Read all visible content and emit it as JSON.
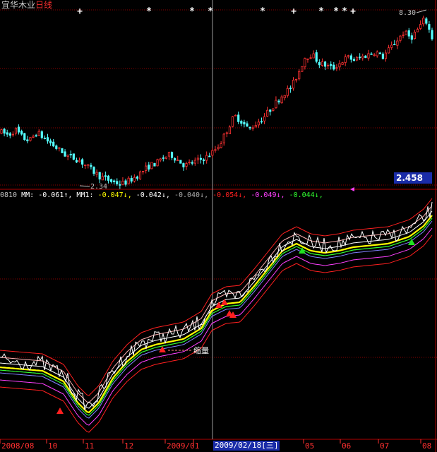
{
  "header": {
    "stock_name": "宜华木业",
    "period": "日线",
    "colors": {
      "name": "#c8c8c8",
      "period": "#ff3030"
    }
  },
  "price_panel": {
    "current_price_label": "2.458",
    "high_label": "8.30",
    "low_label": "2.34",
    "marks_label": "+",
    "stars_label": "*",
    "bull_color": "#ff3232",
    "bear_color": "#54ffff"
  },
  "indicator_panel": {
    "code": "0810",
    "mm_label": "MM:",
    "mm_value": "-0.061↑,",
    "mm1_label": "MM1:",
    "mm1_value": "-0.047↓,",
    "v3": "-0.042↓,",
    "v4": "-0.040↓,",
    "v5": "-0.054↓,",
    "v6": "-0.049↓,",
    "v7": "-0.044↓,",
    "annotation": "缩量",
    "colors": {
      "white": "#ffffff",
      "yellow": "#ffff00",
      "green": "#30ff30",
      "red": "#ff2020",
      "magenta": "#ff40ff",
      "buy_marker": "#ff2020",
      "sell_marker": "#20e020"
    }
  },
  "axis": {
    "labels": [
      "2008/08",
      "10",
      "11",
      "12",
      "2009/01",
      "02",
      "05",
      "06",
      "07",
      "08"
    ],
    "selected_date": "2009/02/18[三]"
  },
  "chart_data": [
    {
      "type": "line",
      "title": "宜华木业 日线",
      "x_ticks": [
        "2008/08",
        "10",
        "11",
        "12",
        "2009/01",
        "02",
        "05",
        "06",
        "07",
        "08"
      ],
      "y_annotations": {
        "high": 8.3,
        "low": 2.34,
        "current": 2.458
      },
      "series": [
        {
          "values": [
            4.2,
            4.1,
            4.3,
            4.0,
            3.9,
            4.2,
            4.0,
            3.8,
            3.6,
            3.4,
            3.3,
            3.2,
            3.0,
            2.8,
            2.6,
            2.5,
            2.4,
            2.34,
            2.45,
            2.6,
            2.8,
            3.0,
            3.1,
            3.3,
            3.4,
            3.2,
            3.0,
            3.1,
            3.2,
            3.3,
            3.5,
            3.8,
            4.3,
            4.8,
            4.6,
            4.3,
            4.5,
            4.7,
            5.0,
            5.3,
            5.6,
            5.8,
            6.3,
            6.9,
            7.0,
            6.7,
            6.6,
            6.5,
            6.7,
            6.9,
            6.8,
            6.9,
            7.0,
            7.1,
            6.9,
            7.2,
            7.5,
            7.8,
            7.6,
            7.9,
            8.3,
            7.6
          ]
        }
      ]
    },
    {
      "type": "line",
      "title": "0810",
      "series": [
        {
          "name": "MM",
          "values": [
            -0.061
          ]
        },
        {
          "name": "MM1",
          "values": [
            -0.047
          ]
        }
      ],
      "last_values": [
        -0.061,
        -0.047,
        -0.042,
        -0.04,
        -0.054,
        -0.049,
        -0.044
      ]
    }
  ]
}
